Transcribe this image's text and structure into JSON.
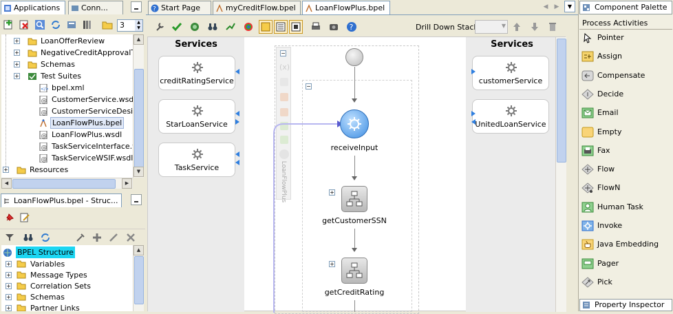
{
  "left_top": {
    "tabs": [
      "Applications",
      "Conn..."
    ],
    "spin_value": "3",
    "tree": [
      {
        "label": "LoanOfferReview",
        "icon": "folder",
        "indent": 1,
        "expander": "+"
      },
      {
        "label": "NegativeCreditApprovalTask",
        "icon": "folder",
        "indent": 1,
        "expander": "+"
      },
      {
        "label": "Schemas",
        "icon": "folder",
        "indent": 1,
        "expander": "+"
      },
      {
        "label": "Test Suites",
        "icon": "test-suites",
        "indent": 1,
        "expander": "+"
      },
      {
        "label": "bpel.xml",
        "icon": "xml-file",
        "indent": 2,
        "expander": ""
      },
      {
        "label": "CustomerService.wsdl",
        "icon": "wsdl-file",
        "indent": 2,
        "expander": ""
      },
      {
        "label": "CustomerServiceDesign.wsdl",
        "icon": "wsdl-file",
        "indent": 2,
        "expander": ""
      },
      {
        "label": "LoanFlowPlus.bpel",
        "icon": "bpel-file",
        "indent": 2,
        "expander": "",
        "selected": true
      },
      {
        "label": "LoanFlowPlus.wsdl",
        "icon": "wsdl-file",
        "indent": 2,
        "expander": ""
      },
      {
        "label": "TaskServiceInterface.wsdl",
        "icon": "wsdl-file",
        "indent": 2,
        "expander": ""
      },
      {
        "label": "TaskServiceWSIF.wsdl",
        "icon": "wsdl-file",
        "indent": 2,
        "expander": ""
      },
      {
        "label": "Resources",
        "icon": "folder",
        "indent": 0,
        "expander": "+"
      }
    ]
  },
  "structure": {
    "title": "LoanFlowPlus.bpel - Struc...",
    "root": "BPEL Structure",
    "items": [
      "Variables",
      "Message Types",
      "Correlation Sets",
      "Schemas",
      "Partner Links"
    ]
  },
  "editor": {
    "tabs": [
      "Start Page",
      "myCreditFlow.bpel",
      "LoanFlowPlus.bpel"
    ],
    "drill_down_label": "Drill Down Stack:",
    "left_services_title": "Services",
    "right_services_title": "Services",
    "left_services": [
      "creditRatingService",
      "StarLoanService",
      "TaskService"
    ],
    "right_services": [
      "customerService",
      "UnitedLoanService"
    ],
    "scope_label": "LoanFlowPlus",
    "activities": [
      "receiveInput",
      "getCustomerSSN",
      "getCreditRating"
    ]
  },
  "palette": {
    "title": "Component Palette",
    "category": "Process Activities",
    "items": [
      {
        "label": "Pointer",
        "icon": "pointer-icon",
        "color": "#ffffff"
      },
      {
        "label": "Assign",
        "icon": "assign-icon",
        "color": "#f5d36b"
      },
      {
        "label": "Compensate",
        "icon": "compensate-icon",
        "color": "#d8d8d8"
      },
      {
        "label": "Decide",
        "icon": "decide-icon",
        "color": "#d8d8d8"
      },
      {
        "label": "Email",
        "icon": "email-icon",
        "color": "#8fd08f"
      },
      {
        "label": "Empty",
        "icon": "empty-icon",
        "color": "#f9d477"
      },
      {
        "label": "Fax",
        "icon": "fax-icon",
        "color": "#8fd08f"
      },
      {
        "label": "Flow",
        "icon": "flow-icon",
        "color": "#d8d8d8"
      },
      {
        "label": "FlowN",
        "icon": "flown-icon",
        "color": "#d8d8d8"
      },
      {
        "label": "Human Task",
        "icon": "human-task-icon",
        "color": "#8fd08f"
      },
      {
        "label": "Invoke",
        "icon": "invoke-icon",
        "color": "#7fb3e8"
      },
      {
        "label": "Java Embedding",
        "icon": "java-embedding-icon",
        "color": "#f9d477"
      },
      {
        "label": "Pager",
        "icon": "pager-icon",
        "color": "#8fd08f"
      },
      {
        "label": "Pick",
        "icon": "pick-icon",
        "color": "#d8d8d8"
      }
    ],
    "property_inspector": "Property Inspector"
  }
}
